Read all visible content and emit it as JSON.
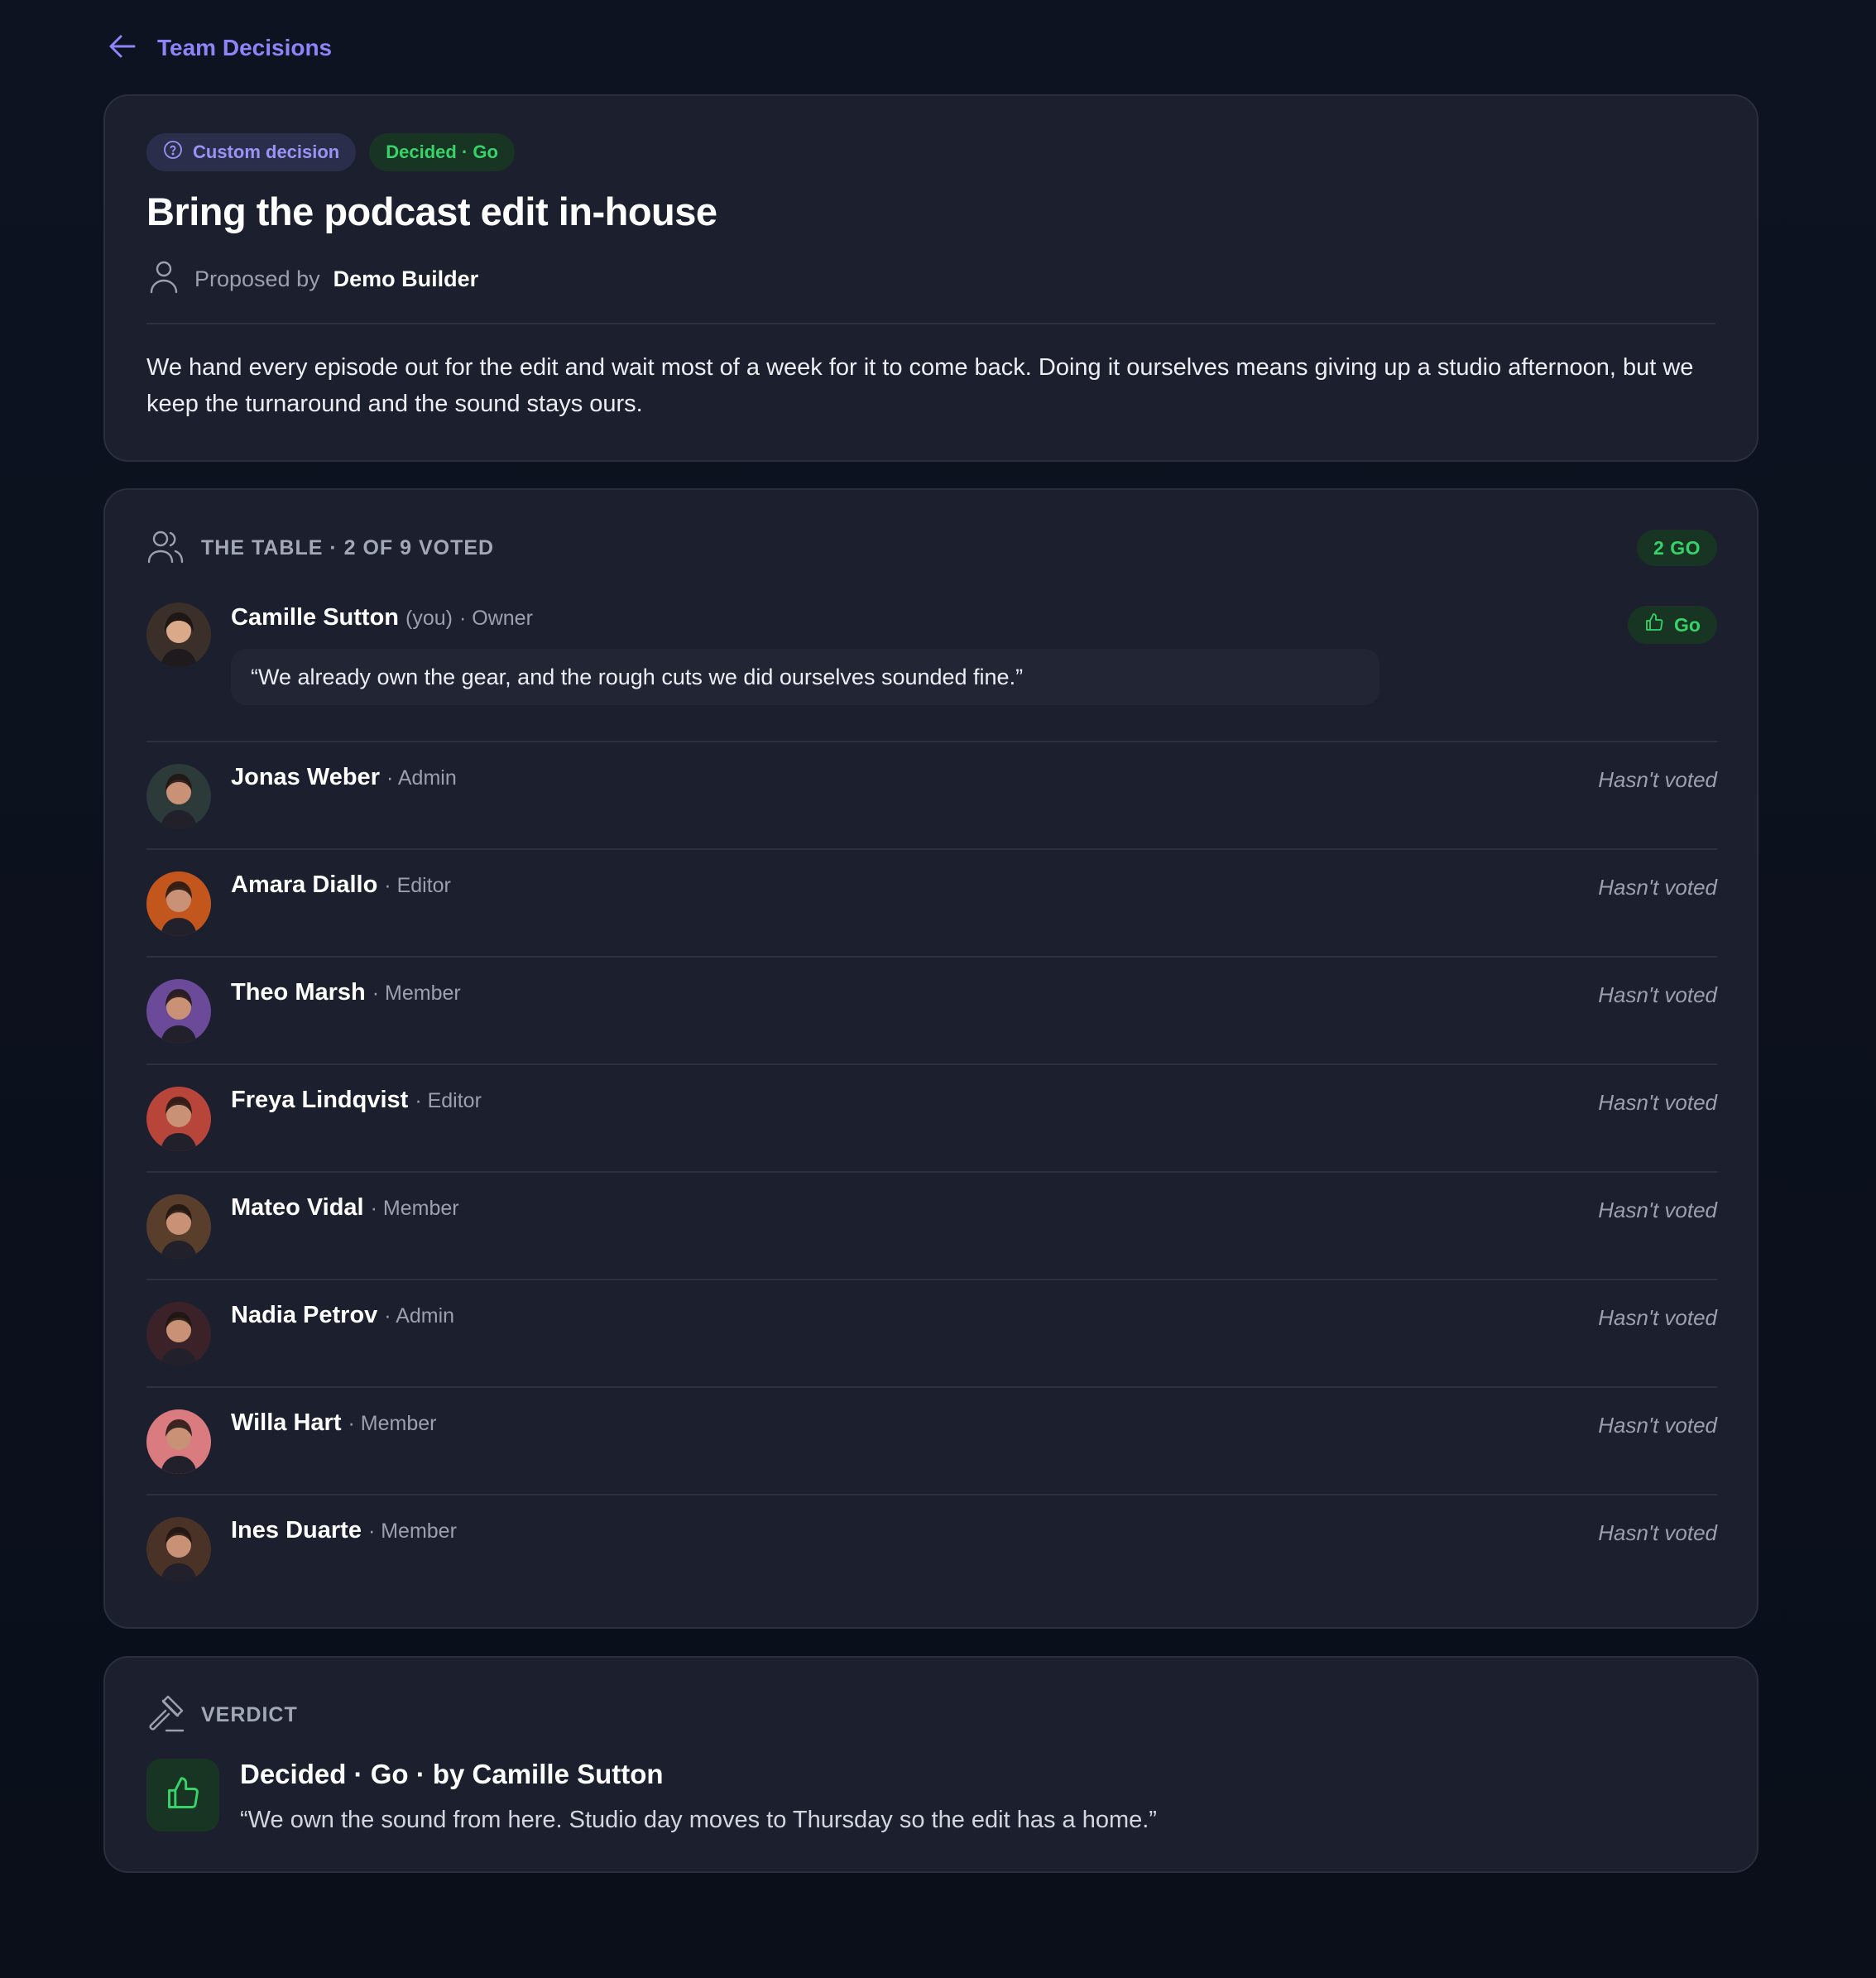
{
  "nav": {
    "back_label": "Team Decisions",
    "back_icon": "arrow-left-icon"
  },
  "decision": {
    "type_chip": "Custom decision",
    "status_chip": "Decided · Go",
    "title": "Bring the podcast edit in-house",
    "proposed_label": "Proposed by",
    "proposer": "Demo Builder",
    "description": "We hand every episode out for the edit and wait most of a week for it to come back. Doing it ourselves means giving up a studio afternoon, but we keep the turnaround and the sound stays ours."
  },
  "table": {
    "heading": "THE TABLE · 2 OF 9 VOTED",
    "tally": "2 GO",
    "members": [
      {
        "name": "Camille Sutton",
        "you": "(you)",
        "role": "· Owner",
        "vote": "Go",
        "comment": "“We already own the gear, and the rough cuts we did ourselves sounded fine.”",
        "avatar_color": "#3b2f2a"
      },
      {
        "name": "Jonas Weber",
        "role": "· Admin",
        "status": "Hasn't voted",
        "avatar_color": "#2c3a3a"
      },
      {
        "name": "Amara Diallo",
        "role": "· Editor",
        "status": "Hasn't voted",
        "avatar_color": "#c2561d"
      },
      {
        "name": "Theo Marsh",
        "role": "· Member",
        "status": "Hasn't voted",
        "avatar_color": "#6b4a9a"
      },
      {
        "name": "Freya Lindqvist",
        "role": "· Editor",
        "status": "Hasn't voted",
        "avatar_color": "#b8453a"
      },
      {
        "name": "Mateo Vidal",
        "role": "· Member",
        "status": "Hasn't voted",
        "avatar_color": "#5a3e2c"
      },
      {
        "name": "Nadia Petrov",
        "role": "· Admin",
        "status": "Hasn't voted",
        "avatar_color": "#3a2228"
      },
      {
        "name": "Willa Hart",
        "role": "· Member",
        "status": "Hasn't voted",
        "avatar_color": "#d97b7f"
      },
      {
        "name": "Ines Duarte",
        "role": "· Member",
        "status": "Hasn't voted",
        "avatar_color": "#4a3226"
      }
    ]
  },
  "verdict": {
    "heading": "VERDICT",
    "title": "Decided · Go · by Camille Sutton",
    "quote": "“We own the sound from here. Studio day moves to Thursday so the edit has a home.”"
  },
  "colors": {
    "accent": "#8d84f7",
    "go_green": "#37d36a",
    "card_bg": "#1c1f2d",
    "page_bg": "#0b101b"
  }
}
